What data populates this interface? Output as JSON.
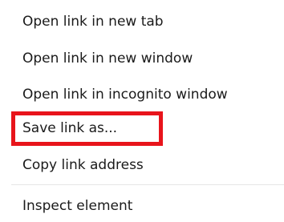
{
  "context_menu": {
    "items": [
      {
        "label": "Open link in new tab"
      },
      {
        "label": "Open link in new window"
      },
      {
        "label": "Open link in incognito window"
      },
      {
        "label": "Save link as..."
      },
      {
        "label": "Copy link address"
      },
      {
        "label": "Inspect element"
      }
    ],
    "highlighted_item": "Save link as...",
    "highlight_color": "#e8141b"
  }
}
